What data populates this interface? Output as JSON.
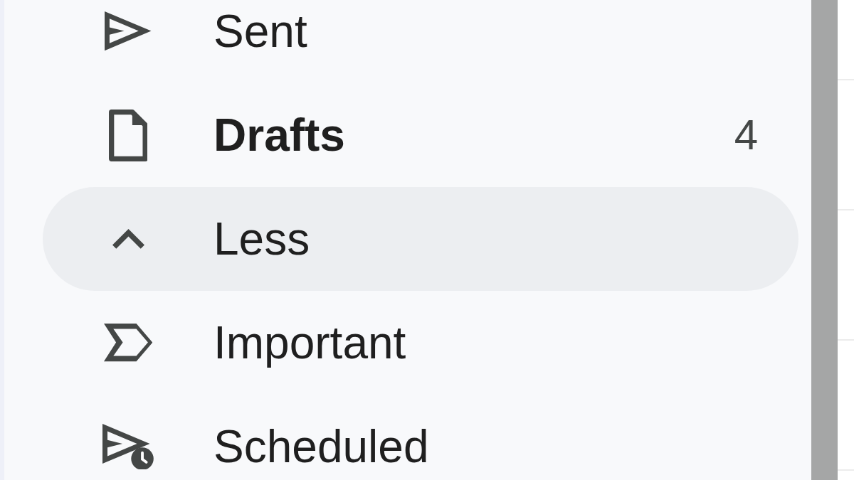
{
  "sidebar": {
    "items": [
      {
        "kind": "folder",
        "label": "Sent",
        "unread": false,
        "highlighted": false
      },
      {
        "kind": "folder",
        "label": "Drafts",
        "unread": true,
        "count": "4",
        "highlighted": false
      },
      {
        "kind": "toggle",
        "label": "Less",
        "expanded": true,
        "highlighted": true
      },
      {
        "kind": "folder",
        "label": "Important",
        "unread": false,
        "highlighted": false
      },
      {
        "kind": "folder",
        "label": "Scheduled",
        "unread": false,
        "highlighted": false
      }
    ]
  }
}
